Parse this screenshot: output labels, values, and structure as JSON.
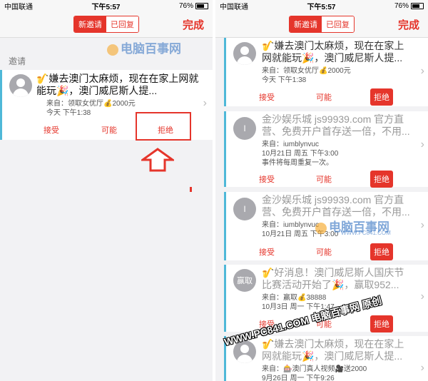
{
  "status_left": {
    "carrier": "中国联通",
    "time": "下午5:57",
    "battery": "76%"
  },
  "status_right": {
    "carrier": "中国联通",
    "time": "下午5:57",
    "battery": "76%"
  },
  "nav": {
    "tab_new": "新邀请",
    "tab_replied": "已回复",
    "done": "完成"
  },
  "section_label": "邀请",
  "left_invite": {
    "title": "🎷嫌去澳门太麻烦，现在在家上网就能玩🎉，澳门威尼斯人提...",
    "from": "来自：领取女优厅💰2000元",
    "time": "今天 下午1:38",
    "accept": "接受",
    "maybe": "可能",
    "decline": "拒绝"
  },
  "right_invites": [
    {
      "avatar": "",
      "title": "🎷嫌去澳门太麻烦，现在在家上网就能玩🎉，澳门威尼斯人提...",
      "line1": "来自：领取女优厅💰2000元",
      "line2": "今天 下午1:38",
      "line3": "",
      "accept": "接受",
      "maybe": "可能",
      "decline": "拒绝"
    },
    {
      "avatar": "I",
      "title": "金沙娱乐城 js99939.com 官方直营、免费开户首存送一倍，不用...",
      "line1": "来自：iumblynvuc",
      "line2": "10月21日 周五 下午3:00",
      "line3": "事件将每周重复一次。",
      "accept": "接受",
      "maybe": "可能",
      "decline": "拒绝"
    },
    {
      "avatar": "I",
      "title": "金沙娱乐城 js99939.com 官方直营、免费开户首存送一倍，不用...",
      "line1": "来自：iumblynvuc",
      "line2": "10月21日 周五 下午3:00",
      "line3": "",
      "accept": "接受",
      "maybe": "可能",
      "decline": "拒绝"
    },
    {
      "avatar": "赢取",
      "title": "🎷好消息！澳门威尼斯人国庆节比赛活动开始了🎉，赢取952...",
      "line1": "来自：赢取💰38888",
      "line2": "10月3日 周一 下午1:47",
      "line3": "",
      "accept": "接受",
      "maybe": "可能",
      "decline": "拒绝"
    },
    {
      "avatar": "",
      "title": "🎷嫌去澳门太麻烦，现在在家上网就能玩🎉，澳门威尼斯人提...",
      "line1": "来自：🎰澳门真人视频🎥送2000",
      "line2": "9月26日 周一 下午9:26",
      "line3": "",
      "accept": "",
      "maybe": "",
      "decline": ""
    }
  ],
  "watermark_text": "电脑百事网",
  "watermark_sub": "WWW.PC841.COM",
  "watermark_diag": "WWW.PC841.COM 电脑百事网 原创",
  "colors": {
    "accent": "#e5352b",
    "card_bar": "#4fb8d8",
    "watermark": "#2f6fc0"
  }
}
